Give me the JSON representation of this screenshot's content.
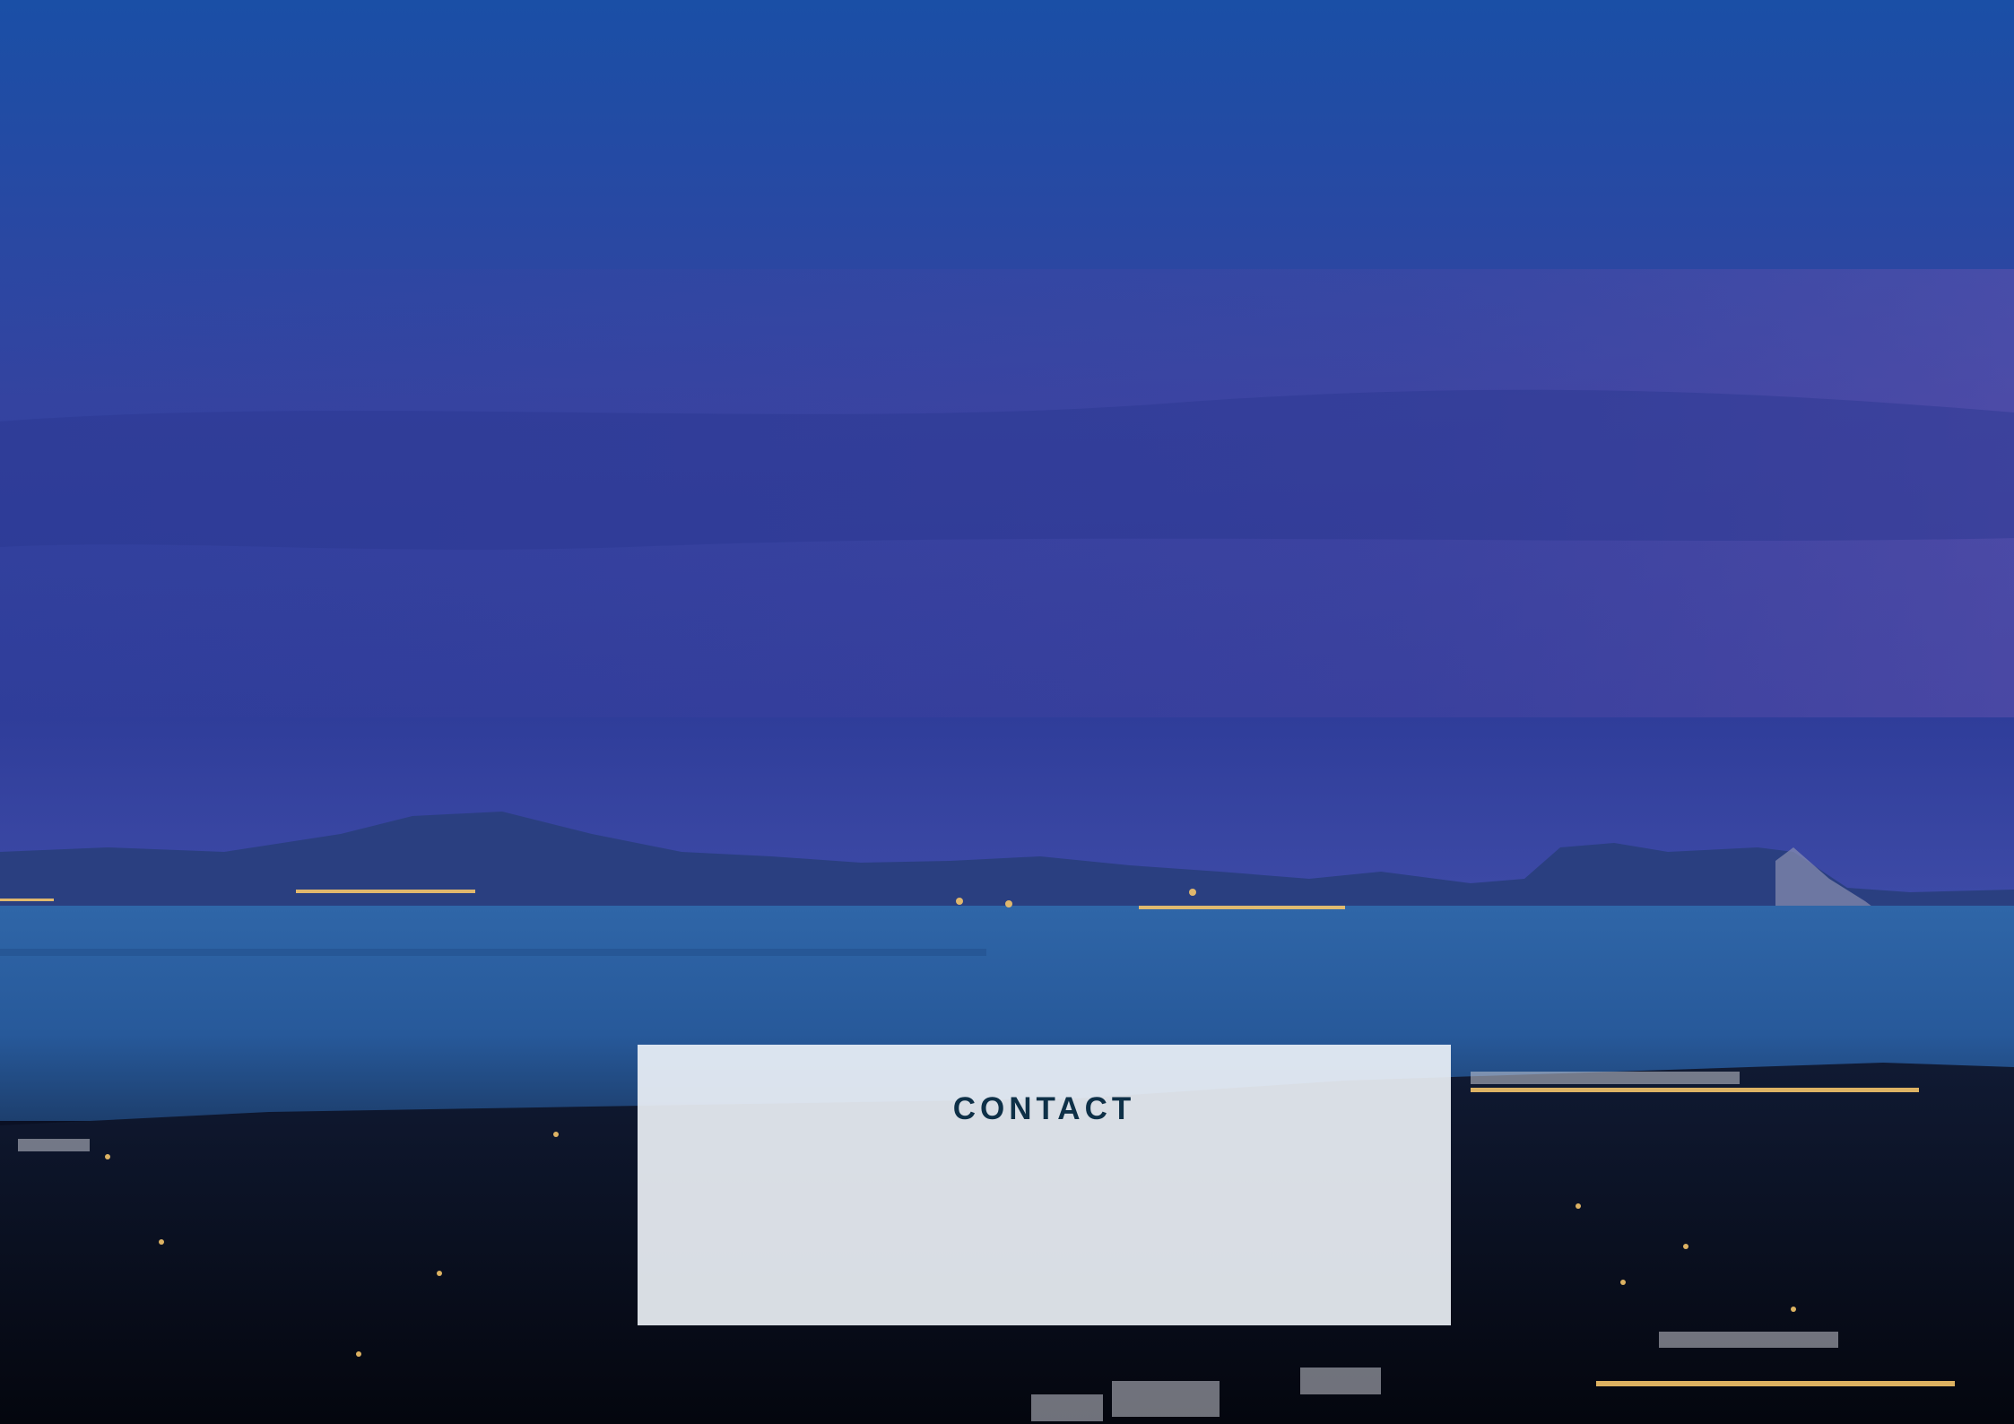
{
  "contact_panel": {
    "title": "CONTACT"
  },
  "colors": {
    "sky_top": "#1d4fa0",
    "sky_mid": "#3a3f9e",
    "sea": "#2a5c9c",
    "night_land": "#070b18",
    "panel_bg": "#eef2f8",
    "title_text": "#0e3047"
  }
}
